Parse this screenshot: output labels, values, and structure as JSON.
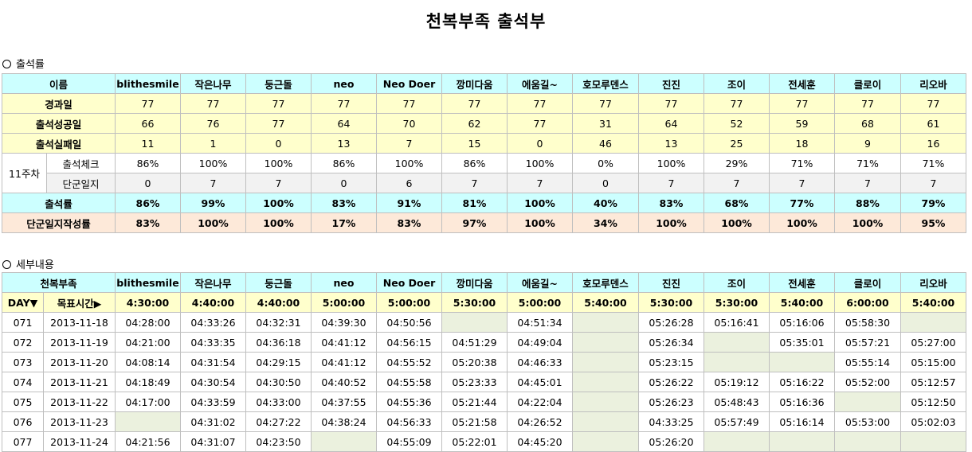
{
  "title": "천복부족 출석부",
  "sections": {
    "rate": "출석률",
    "detail": "세부내용"
  },
  "summary": {
    "header_label": "이름",
    "names": [
      "blithesmile",
      "작은나무",
      "둥근돌",
      "neo",
      "Neo Doer",
      "깡미다움",
      "에움길~",
      "호모루덴스",
      "진진",
      "조이",
      "전세훈",
      "클로이",
      "리오바"
    ],
    "rows": [
      {
        "label": "경과일",
        "values": [
          "77",
          "77",
          "77",
          "77",
          "77",
          "77",
          "77",
          "77",
          "77",
          "77",
          "77",
          "77",
          "77"
        ]
      },
      {
        "label": "출석성공일",
        "values": [
          "66",
          "76",
          "77",
          "64",
          "70",
          "62",
          "77",
          "31",
          "64",
          "52",
          "59",
          "68",
          "61"
        ]
      },
      {
        "label": "출석실패일",
        "values": [
          "11",
          "1",
          "0",
          "13",
          "7",
          "15",
          "0",
          "46",
          "13",
          "25",
          "18",
          "9",
          "16"
        ]
      }
    ],
    "week": {
      "label": "11주차",
      "rows": [
        {
          "label": "출석체크",
          "values": [
            "86%",
            "100%",
            "100%",
            "86%",
            "100%",
            "86%",
            "100%",
            "0%",
            "100%",
            "29%",
            "71%",
            "71%",
            "71%"
          ]
        },
        {
          "label": "단군일지",
          "values": [
            "0",
            "7",
            "7",
            "0",
            "6",
            "7",
            "7",
            "0",
            "7",
            "7",
            "7",
            "7",
            "7"
          ]
        }
      ]
    },
    "rate": {
      "label": "출석률",
      "values": [
        "86%",
        "99%",
        "100%",
        "83%",
        "91%",
        "81%",
        "100%",
        "40%",
        "83%",
        "68%",
        "77%",
        "88%",
        "79%"
      ]
    },
    "journal_rate": {
      "label": "단군일지작성률",
      "values": [
        "83%",
        "100%",
        "100%",
        "17%",
        "83%",
        "97%",
        "100%",
        "34%",
        "100%",
        "100%",
        "100%",
        "100%",
        "95%"
      ]
    }
  },
  "detail": {
    "header_label": "천복부족",
    "day_label": "DAY▼",
    "target_label": "목표시간▶",
    "targets": [
      "4:30:00",
      "4:40:00",
      "4:40:00",
      "5:00:00",
      "5:00:00",
      "5:30:00",
      "5:00:00",
      "5:40:00",
      "5:30:00",
      "5:30:00",
      "5:40:00",
      "6:00:00",
      "5:40:00"
    ],
    "rows": [
      {
        "day": "071",
        "date": "2013-11-18",
        "times": [
          "04:28:00",
          "04:33:26",
          "04:32:31",
          "04:39:30",
          "04:50:56",
          "",
          "04:51:34",
          "",
          "05:26:28",
          "05:16:41",
          "05:16:06",
          "05:58:30",
          ""
        ]
      },
      {
        "day": "072",
        "date": "2013-11-19",
        "times": [
          "04:21:00",
          "04:33:35",
          "04:36:18",
          "04:41:12",
          "04:56:15",
          "04:51:29",
          "04:49:04",
          "",
          "05:26:34",
          "",
          "05:35:01",
          "05:57:21",
          "05:27:00"
        ]
      },
      {
        "day": "073",
        "date": "2013-11-20",
        "times": [
          "04:08:14",
          "04:31:54",
          "04:29:15",
          "04:41:12",
          "04:55:52",
          "05:20:38",
          "04:46:33",
          "",
          "05:23:15",
          "",
          "",
          "05:55:14",
          "05:15:00"
        ]
      },
      {
        "day": "074",
        "date": "2013-11-21",
        "times": [
          "04:18:49",
          "04:30:54",
          "04:30:50",
          "04:40:52",
          "04:55:58",
          "05:23:33",
          "04:45:01",
          "",
          "05:26:22",
          "05:19:12",
          "05:16:22",
          "05:52:00",
          "05:12:57"
        ]
      },
      {
        "day": "075",
        "date": "2013-11-22",
        "times": [
          "04:17:00",
          "04:33:59",
          "04:33:00",
          "04:37:55",
          "04:55:36",
          "05:21:44",
          "04:22:04",
          "",
          "05:26:23",
          "05:48:43",
          "05:16:36",
          "",
          "05:12:50"
        ]
      },
      {
        "day": "076",
        "date": "2013-11-23",
        "times": [
          "",
          "04:31:02",
          "04:27:22",
          "04:38:24",
          "04:56:33",
          "05:21:58",
          "04:26:52",
          "",
          "04:33:25",
          "05:57:49",
          "05:16:14",
          "05:53:00",
          "05:02:03"
        ]
      },
      {
        "day": "077",
        "date": "2013-11-24",
        "times": [
          "04:21:56",
          "04:31:07",
          "04:23:50",
          "",
          "04:55:09",
          "05:22:01",
          "04:45:20",
          "",
          "05:26:20",
          "",
          "",
          "",
          ""
        ]
      }
    ]
  }
}
